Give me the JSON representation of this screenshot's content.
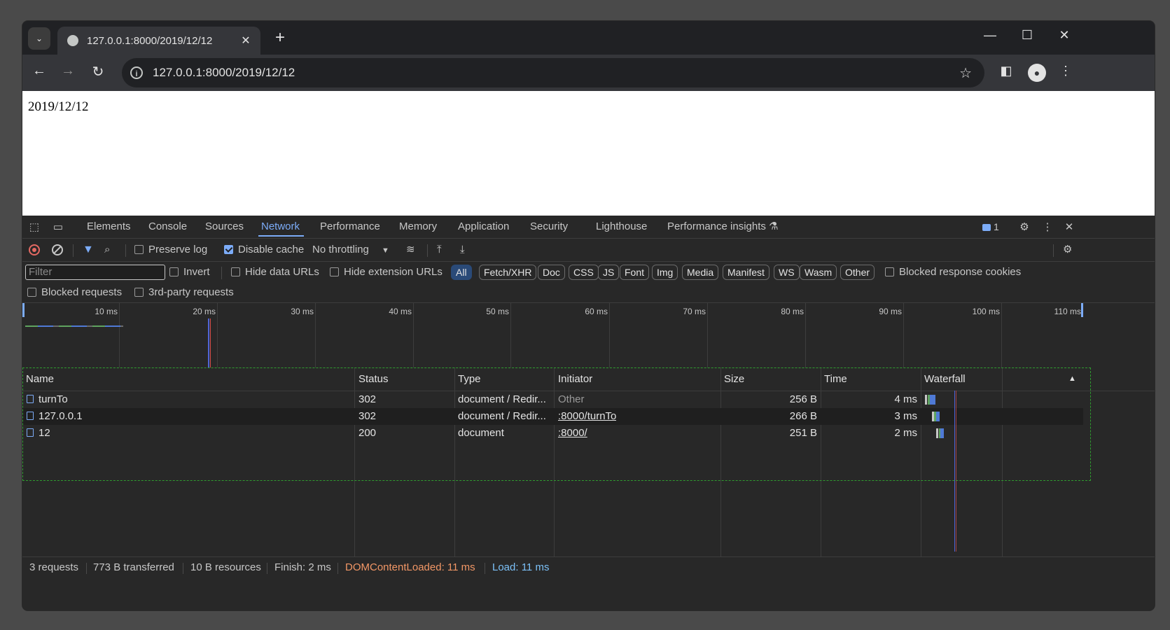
{
  "browser": {
    "tab": {
      "title": "127.0.0.1:8000/2019/12/12",
      "close": "✕"
    },
    "new_tab": "+",
    "window_controls": {
      "minimize": "—",
      "maximize": "☐",
      "close": "✕"
    },
    "nav": {
      "back": "←",
      "forward": "→",
      "reload": "↻"
    },
    "address": "127.0.0.1:8000/2019/12/12"
  },
  "page": {
    "text": "2019/12/12"
  },
  "devtools": {
    "tabs": [
      "Elements",
      "Console",
      "Sources",
      "Network",
      "Performance",
      "Memory",
      "Application",
      "Security",
      "Lighthouse",
      "Performance insights"
    ],
    "active_tab": "Network",
    "issues_count": "1",
    "toolbar": {
      "preserve_log": "Preserve log",
      "disable_cache": "Disable cache",
      "throttling": "No throttling"
    },
    "filter": {
      "placeholder": "Filter",
      "invert": "Invert",
      "hide_data_urls": "Hide data URLs",
      "hide_extension_urls": "Hide extension URLs",
      "types": [
        "All",
        "Fetch/XHR",
        "Doc",
        "CSS",
        "JS",
        "Font",
        "Img",
        "Media",
        "Manifest",
        "WS",
        "Wasm",
        "Other"
      ],
      "blocked_response_cookies": "Blocked response cookies",
      "blocked_requests": "Blocked requests",
      "third_party": "3rd-party requests"
    },
    "overview": {
      "ticks": [
        "10 ms",
        "20 ms",
        "30 ms",
        "40 ms",
        "50 ms",
        "60 ms",
        "70 ms",
        "80 ms",
        "90 ms",
        "100 ms",
        "110 ms"
      ]
    },
    "table": {
      "headers": {
        "name": "Name",
        "status": "Status",
        "type": "Type",
        "initiator": "Initiator",
        "size": "Size",
        "time": "Time",
        "waterfall": "Waterfall"
      },
      "rows": [
        {
          "name": "turnTo",
          "status": "302",
          "type": "document / Redir...",
          "initiator": "Other",
          "size": "256 B",
          "time": "4 ms"
        },
        {
          "name": "127.0.0.1",
          "status": "302",
          "type": "document / Redir...",
          "initiator": ":8000/turnTo",
          "size": "266 B",
          "time": "3 ms"
        },
        {
          "name": "12",
          "status": "200",
          "type": "document",
          "initiator": ":8000/",
          "size": "251 B",
          "time": "2 ms"
        }
      ]
    },
    "status": {
      "requests": "3 requests",
      "transferred": "773 B transferred",
      "resources": "10 B resources",
      "finish": "Finish: 2 ms",
      "dcl": "DOMContentLoaded: 11 ms",
      "load": "Load: 11 ms"
    }
  },
  "colors": {
    "accent": "#7cacf8",
    "dcl": "#f29766",
    "load": "#7cc1f8",
    "record": "#e46962"
  }
}
